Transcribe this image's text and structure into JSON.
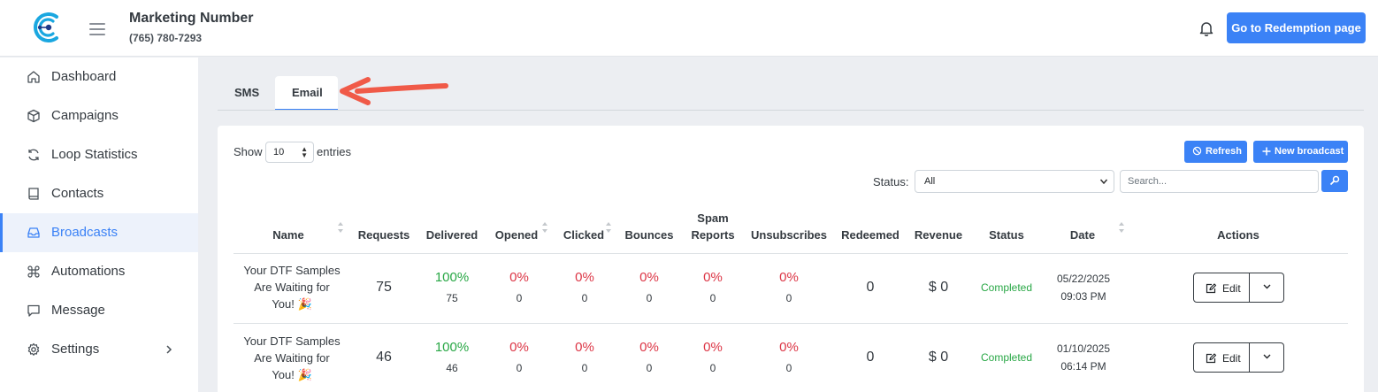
{
  "header": {
    "business_name": "Marketing Number",
    "phone": "(765) 780-7293",
    "redemption_button": "Go to Redemption page"
  },
  "sidebar": {
    "items": [
      {
        "label": "Dashboard",
        "icon": "home-icon"
      },
      {
        "label": "Campaigns",
        "icon": "box-icon"
      },
      {
        "label": "Loop Statistics",
        "icon": "refresh-icon"
      },
      {
        "label": "Contacts",
        "icon": "book-icon"
      },
      {
        "label": "Broadcasts",
        "icon": "inbox-icon",
        "active": true
      },
      {
        "label": "Automations",
        "icon": "command-icon"
      },
      {
        "label": "Message",
        "icon": "message-icon"
      },
      {
        "label": "Settings",
        "icon": "gear-icon"
      }
    ]
  },
  "tabs": [
    {
      "label": "SMS"
    },
    {
      "label": "Email",
      "active": true
    }
  ],
  "controls": {
    "show_label": "Show",
    "entries_value": "10",
    "entries_label": "entries",
    "refresh_label": "Refresh",
    "new_broadcast_label": "New broadcast",
    "status_label": "Status:",
    "status_value": "All",
    "search_placeholder": "Search..."
  },
  "table": {
    "headers": {
      "name": "Name",
      "requests": "Requests",
      "delivered": "Delivered",
      "opened": "Opened",
      "clicked": "Clicked",
      "bounces": "Bounces",
      "spam_line1": "Spam",
      "spam_line2": "Reports",
      "unsubscribes": "Unsubscribes",
      "redeemed": "Redeemed",
      "revenue": "Revenue",
      "status": "Status",
      "date": "Date",
      "actions": "Actions"
    },
    "rows": [
      {
        "name_l1": "Your DTF Samples",
        "name_l2": "Are Waiting for",
        "name_l3": "You! 🎉",
        "requests": "75",
        "delivered_pct": "100%",
        "delivered": "75",
        "opened_pct": "0%",
        "opened": "0",
        "clicked_pct": "0%",
        "clicked": "0",
        "bounces_pct": "0%",
        "bounces": "0",
        "spam_pct": "0%",
        "spam": "0",
        "unsub_pct": "0%",
        "unsub": "0",
        "redeemed": "0",
        "revenue": "$ 0",
        "status": "Completed",
        "date": "05/22/2025",
        "time": "09:03 PM",
        "edit_label": "Edit"
      },
      {
        "name_l1": "Your DTF Samples",
        "name_l2": "Are Waiting for",
        "name_l3": "You! 🎉",
        "requests": "46",
        "delivered_pct": "100%",
        "delivered": "46",
        "opened_pct": "0%",
        "opened": "0",
        "clicked_pct": "0%",
        "clicked": "0",
        "bounces_pct": "0%",
        "bounces": "0",
        "spam_pct": "0%",
        "spam": "0",
        "unsub_pct": "0%",
        "unsub": "0",
        "redeemed": "0",
        "revenue": "$ 0",
        "status": "Completed",
        "date": "01/10/2025",
        "time": "06:14 PM",
        "edit_label": "Edit"
      }
    ]
  },
  "colors": {
    "accent": "#3b82f6",
    "success": "#28a745",
    "danger": "#dc3545",
    "annotation_arrow": "#f05a48"
  }
}
